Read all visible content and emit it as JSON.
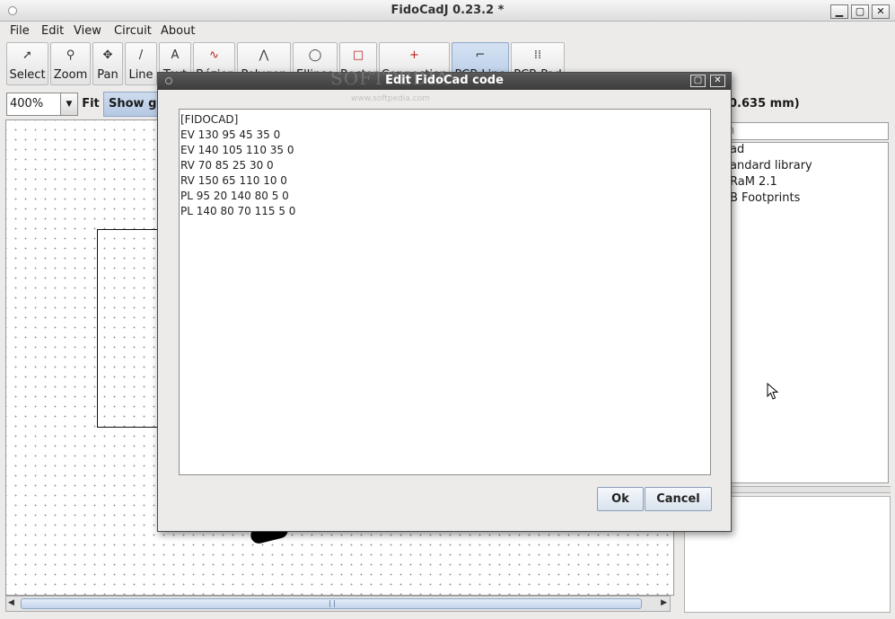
{
  "window": {
    "title": "FidoCadJ 0.23.2  *",
    "minimize": "▁",
    "maximize": "▢",
    "close": "✕"
  },
  "menu": [
    "File",
    "Edit",
    "View",
    "Circuit",
    "About"
  ],
  "toolbar": {
    "tools": [
      {
        "label": "Select",
        "icon": "arrow-icon"
      },
      {
        "label": "Zoom",
        "icon": "magnifier-icon"
      },
      {
        "label": "Pan",
        "icon": "move-icon"
      },
      {
        "label": "Line",
        "icon": "line-icon"
      },
      {
        "label": "Text",
        "icon": "text-icon"
      },
      {
        "label": "Bézier",
        "icon": "bezier-icon"
      },
      {
        "label": "Polygon",
        "icon": "polygon-icon"
      },
      {
        "label": "Ellipse",
        "icon": "ellipse-icon"
      },
      {
        "label": "Rectangle",
        "icon": "rectangle-icon"
      },
      {
        "label": "Connection",
        "icon": "connection-icon"
      },
      {
        "label": "PCB Line",
        "icon": "pcb-line-icon"
      },
      {
        "label": "PCB Pad",
        "icon": "pcb-pad-icon"
      }
    ],
    "zoom_value": "400%",
    "fit_label": "Fit",
    "grid_label": "Show grid",
    "coord_readout": "0.635 mm)"
  },
  "library": {
    "search_placeholder": "h",
    "items": [
      "ad",
      "andard library",
      "RaM 2.1",
      "B Footprints"
    ]
  },
  "dialog": {
    "title": "Edit FidoCad code",
    "watermark": "SOFTPEDIA",
    "watermark_url": "www.softpedia.com",
    "code_lines": [
      "[FIDOCAD]",
      "EV 130 95 45 35 0",
      "EV 140 105 110 35 0",
      "RV 70 85 25 30 0",
      "RV 150 65 110 10 0",
      "PL 95 20 140 80 5 0",
      "PL 140 80 70 115 5 0"
    ],
    "ok_label": "Ok",
    "cancel_label": "Cancel",
    "maximize": "▢",
    "close": "✕"
  }
}
